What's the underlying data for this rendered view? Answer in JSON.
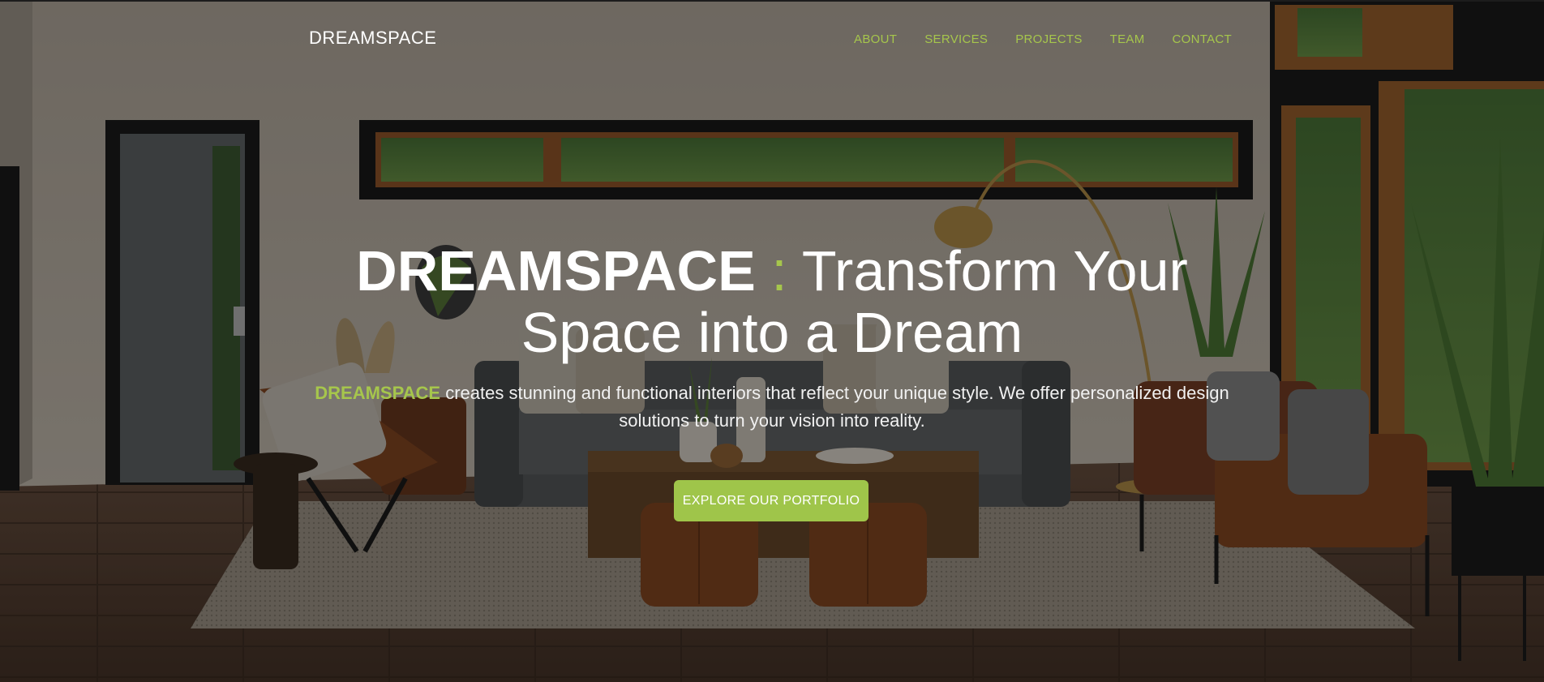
{
  "header": {
    "brand": "DREAMSPACE",
    "nav": [
      "ABOUT",
      "SERVICES",
      "PROJECTS",
      "TEAM",
      "CONTACT"
    ]
  },
  "hero": {
    "headline_brand": "DREAMSPACE",
    "headline_colon": ":",
    "headline_rest": "Transform Your Space into a Dream",
    "sub_brand": "DREAMSPACE",
    "sub_text": "creates stunning and functional interiors that reflect your unique style. We offer personalized design solutions to turn your vision into reality.",
    "cta_label": "EXPLORE OUR PORTFOLIO"
  },
  "colors": {
    "accent": "#a6c64c",
    "text": "#ffffff"
  }
}
